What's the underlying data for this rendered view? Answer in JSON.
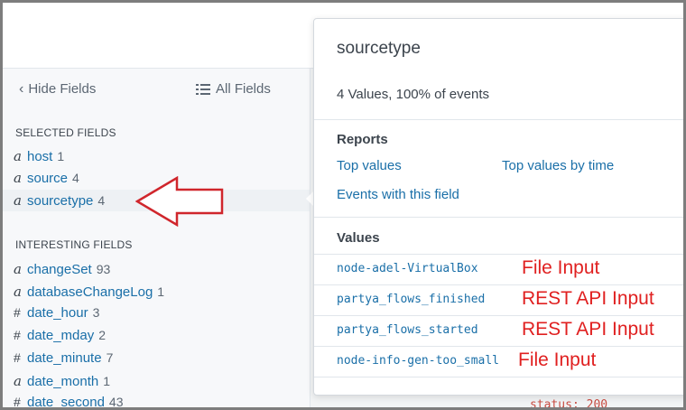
{
  "sidebar": {
    "hide_fields_label": "Hide Fields",
    "all_fields_label": "All Fields",
    "selected_title": "SELECTED FIELDS",
    "selected_fields": [
      {
        "type": "a",
        "name": "host",
        "count": "1"
      },
      {
        "type": "a",
        "name": "source",
        "count": "4"
      },
      {
        "type": "a",
        "name": "sourcetype",
        "count": "4"
      }
    ],
    "interesting_title": "INTERESTING FIELDS",
    "interesting_fields": [
      {
        "type": "a",
        "name": "changeSet",
        "count": "93"
      },
      {
        "type": "a",
        "name": "databaseChangeLog",
        "count": "1"
      },
      {
        "type": "#",
        "name": "date_hour",
        "count": "3"
      },
      {
        "type": "#",
        "name": "date_mday",
        "count": "2"
      },
      {
        "type": "#",
        "name": "date_minute",
        "count": "7"
      },
      {
        "type": "a",
        "name": "date_month",
        "count": "1"
      },
      {
        "type": "#",
        "name": "date_second",
        "count": "43"
      }
    ]
  },
  "popup": {
    "title": "sourcetype",
    "summary": "4 Values, 100% of events",
    "reports_heading": "Reports",
    "report_links": {
      "top_values": "Top values",
      "top_values_by_time": "Top values by time",
      "events_with_field": "Events with this field"
    },
    "values_heading": "Values",
    "values": [
      {
        "value": "node-adel-VirtualBox",
        "annotation": "File Input"
      },
      {
        "value": "partya_flows_finished",
        "annotation": "REST API Input"
      },
      {
        "value": "partya_flows_started",
        "annotation": "REST API Input"
      },
      {
        "value": "node-info-gen-too_small",
        "annotation": "File Input"
      }
    ]
  },
  "background": {
    "partial_text": "status: 200"
  },
  "colors": {
    "link": "#1a6fa8",
    "annotation": "#e02020",
    "arrow": "#d0262c"
  }
}
